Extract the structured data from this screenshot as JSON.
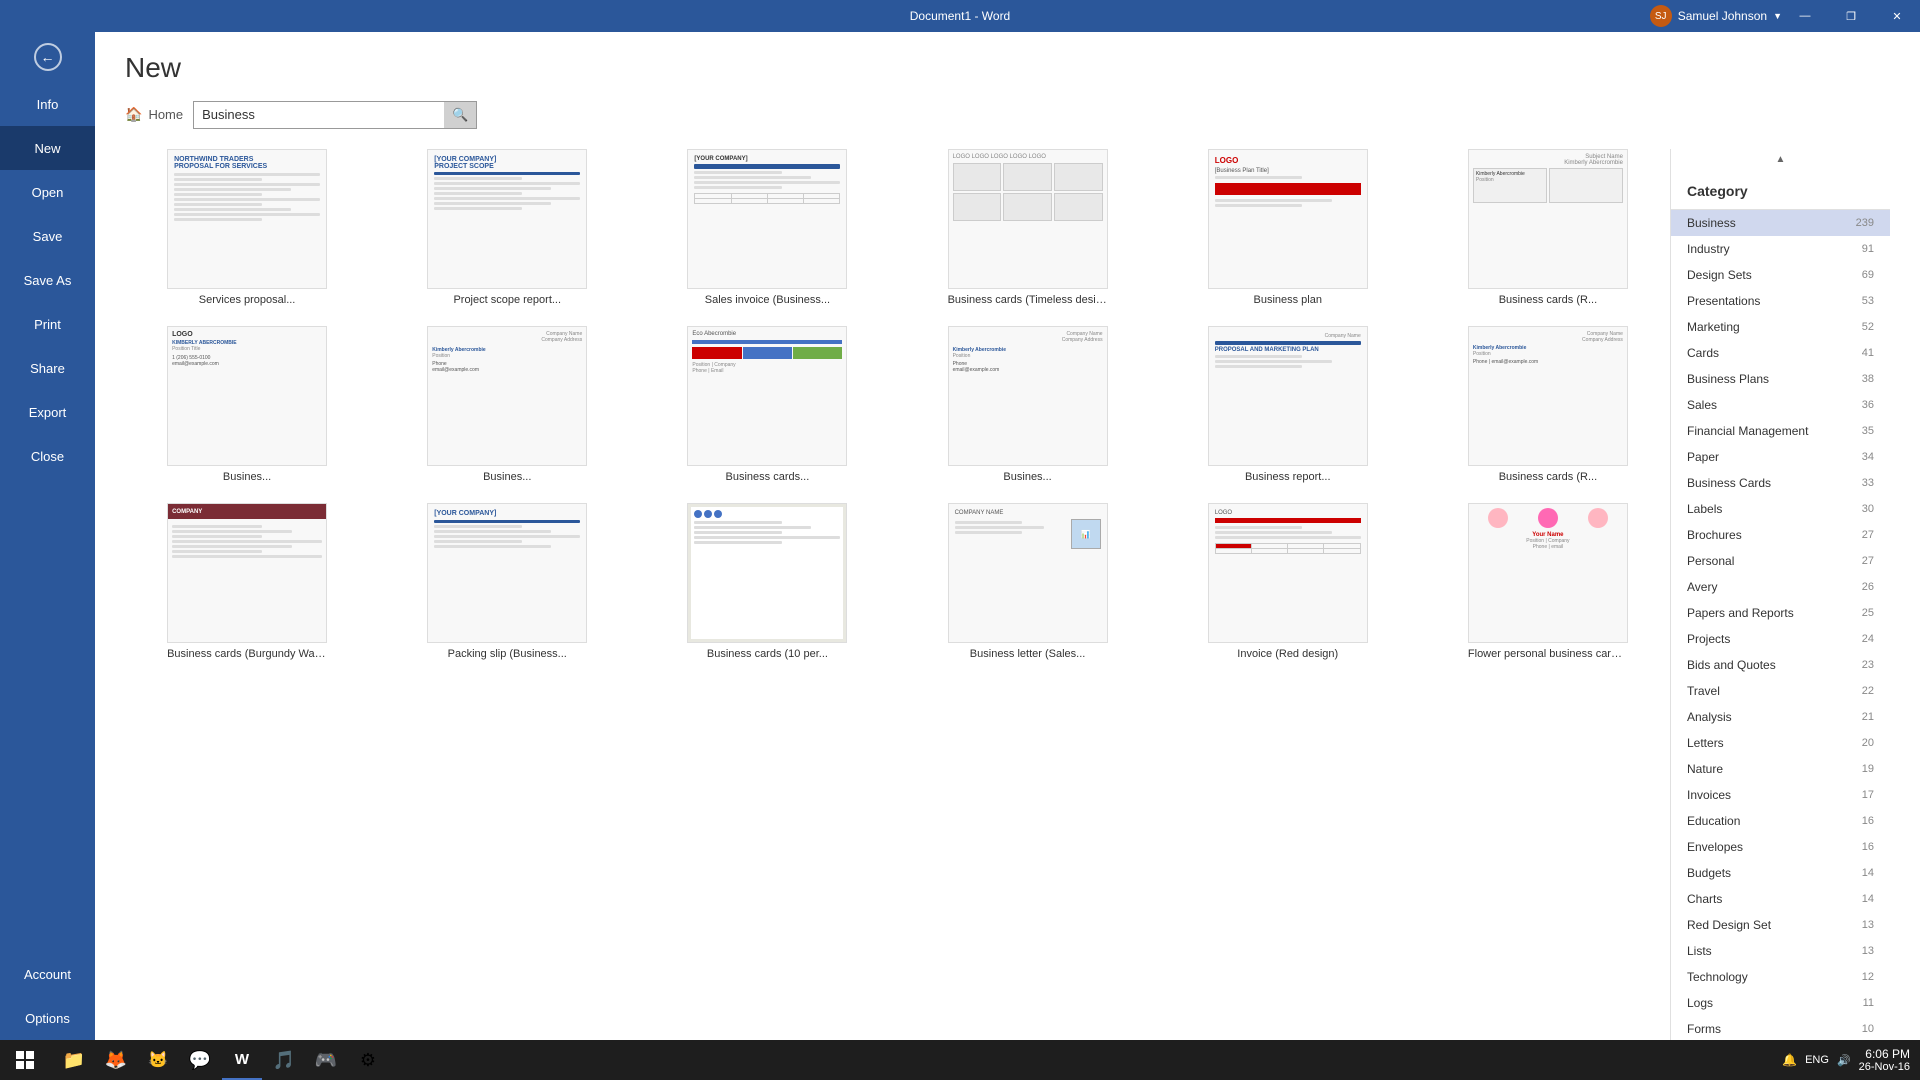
{
  "titlebar": {
    "title": "Document1 - Word",
    "minimize": "—",
    "restore": "❐",
    "close": "✕",
    "user": "Samuel Johnson"
  },
  "sidebar": {
    "back_label": "←",
    "items": [
      {
        "label": "Info",
        "id": "info"
      },
      {
        "label": "New",
        "id": "new",
        "active": true
      },
      {
        "label": "Open",
        "id": "open"
      },
      {
        "label": "Save",
        "id": "save"
      },
      {
        "label": "Save As",
        "id": "save-as"
      },
      {
        "label": "Print",
        "id": "print"
      },
      {
        "label": "Share",
        "id": "share"
      },
      {
        "label": "Export",
        "id": "export"
      },
      {
        "label": "Close",
        "id": "close"
      },
      {
        "label": "Account",
        "id": "account"
      },
      {
        "label": "Options",
        "id": "options"
      }
    ]
  },
  "page": {
    "title": "New",
    "search_placeholder": "Business",
    "home_label": "Home"
  },
  "templates": [
    {
      "label": "Services proposal...",
      "type": "proposal"
    },
    {
      "label": "Project scope report...",
      "type": "scope"
    },
    {
      "label": "Sales invoice (Business...",
      "type": "invoice"
    },
    {
      "label": "Business cards (Timeless design,...",
      "type": "biz-cards-timeless"
    },
    {
      "label": "Business plan",
      "type": "biz-plan"
    },
    {
      "label": "Business cards (R...",
      "type": "biz-cards-r"
    },
    {
      "label": "Busines...",
      "type": "biz1"
    },
    {
      "label": "Busines...",
      "type": "biz2"
    },
    {
      "label": "Business cards...",
      "type": "biz-cards-2"
    },
    {
      "label": "Busines...",
      "type": "biz3"
    },
    {
      "label": "Business report...",
      "type": "biz-report"
    },
    {
      "label": "Business cards (R...",
      "type": "biz-cards-r2"
    },
    {
      "label": "Business cards (Burgundy Wave...",
      "type": "biz-burgundy"
    },
    {
      "label": "Packing slip (Business...",
      "type": "packing"
    },
    {
      "label": "Business cards (10 per...",
      "type": "biz-cards-10"
    },
    {
      "label": "Business letter (Sales...",
      "type": "biz-letter"
    },
    {
      "label": "Invoice (Red design)",
      "type": "invoice-red"
    },
    {
      "label": "Flower personal business cards...",
      "type": "flower-cards"
    }
  ],
  "categories": {
    "header": "Category",
    "items": [
      {
        "label": "Business",
        "count": 239,
        "active": true
      },
      {
        "label": "Industry",
        "count": 91
      },
      {
        "label": "Design Sets",
        "count": 69
      },
      {
        "label": "Presentations",
        "count": 53
      },
      {
        "label": "Marketing",
        "count": 52
      },
      {
        "label": "Cards",
        "count": 41
      },
      {
        "label": "Business Plans",
        "count": 38
      },
      {
        "label": "Sales",
        "count": 36
      },
      {
        "label": "Financial Management",
        "count": 35
      },
      {
        "label": "Paper",
        "count": 34
      },
      {
        "label": "Business Cards",
        "count": 33
      },
      {
        "label": "Labels",
        "count": 30
      },
      {
        "label": "Brochures",
        "count": 27
      },
      {
        "label": "Personal",
        "count": 27
      },
      {
        "label": "Avery",
        "count": 26
      },
      {
        "label": "Papers and Reports",
        "count": 25
      },
      {
        "label": "Projects",
        "count": 24
      },
      {
        "label": "Bids and Quotes",
        "count": 23
      },
      {
        "label": "Travel",
        "count": 22
      },
      {
        "label": "Analysis",
        "count": 21
      },
      {
        "label": "Letters",
        "count": 20
      },
      {
        "label": "Nature",
        "count": 19
      },
      {
        "label": "Invoices",
        "count": 17
      },
      {
        "label": "Education",
        "count": 16
      },
      {
        "label": "Envelopes",
        "count": 16
      },
      {
        "label": "Budgets",
        "count": 14
      },
      {
        "label": "Charts",
        "count": 14
      },
      {
        "label": "Red Design Set",
        "count": 13
      },
      {
        "label": "Lists",
        "count": 13
      },
      {
        "label": "Technology",
        "count": 12
      },
      {
        "label": "Logs",
        "count": 11
      },
      {
        "label": "Forms",
        "count": 10
      }
    ]
  },
  "taskbar": {
    "apps": [
      {
        "name": "file-explorer",
        "icon": "📁"
      },
      {
        "name": "firefox",
        "icon": "🦊"
      },
      {
        "name": "app3",
        "icon": "🐱"
      },
      {
        "name": "skype",
        "icon": "💬"
      },
      {
        "name": "word",
        "icon": "W"
      },
      {
        "name": "music",
        "icon": "🎵"
      },
      {
        "name": "app7",
        "icon": "🎮"
      },
      {
        "name": "app8",
        "icon": "⚙"
      }
    ],
    "time": "6:06 PM",
    "date": "26-Nov-16"
  }
}
